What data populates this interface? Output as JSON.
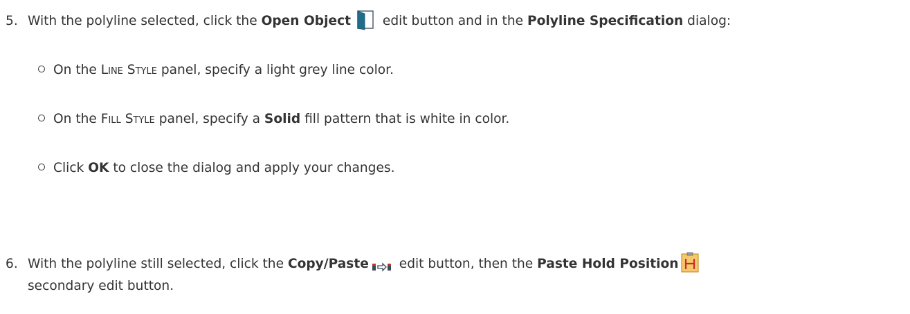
{
  "step5": {
    "number": "5.",
    "text_a": "With the polyline selected, click the ",
    "open_object": "Open Object",
    "text_b": " edit button and in the ",
    "polyline_spec": "Polyline Specification",
    "text_c": " dialog:",
    "bullets": {
      "line_style": {
        "pre": "On the ",
        "panel": "Line Style",
        "post": " panel, specify a light grey line color."
      },
      "fill_style": {
        "pre": "On the ",
        "panel": "Fill Style",
        "mid": " panel, specify a ",
        "solid": "Solid",
        "post": " fill pattern that is white in color."
      },
      "ok": {
        "pre": "Click ",
        "ok": "OK",
        "post": " to close the dialog and apply your changes."
      }
    }
  },
  "step6": {
    "number": "6.",
    "text_a": "With the polyline still selected, click the ",
    "copy_paste": "Copy/Paste",
    "text_b": " edit button, then the ",
    "paste_hold": "Paste Hold Position",
    "line2": "secondary edit button."
  },
  "icons": {
    "open_object": "open-door-icon",
    "copy_paste": "copy-paste-icon",
    "paste_hold": "paste-hold-position-icon"
  },
  "colors": {
    "text": "#333333",
    "door": "#1f6f8b",
    "hold_bg": "#f5c86b",
    "hold_letter": "#cc2a2a"
  }
}
